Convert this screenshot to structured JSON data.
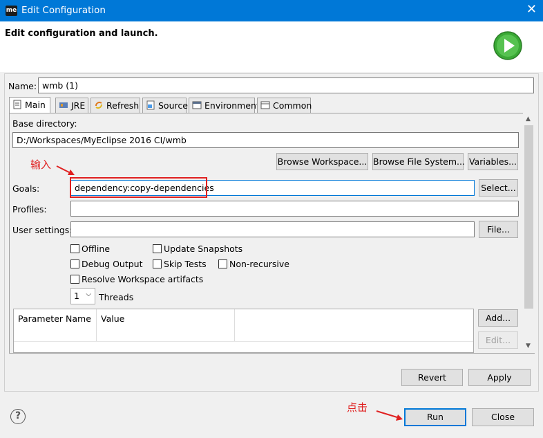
{
  "window": {
    "title": "Edit Configuration",
    "logo_text": "me"
  },
  "header": {
    "title": "Edit configuration and launch."
  },
  "name_field": {
    "label": "Name:",
    "value": "wmb (1)"
  },
  "tabs": [
    {
      "label": "Main",
      "icon": "page-icon"
    },
    {
      "label": "JRE",
      "icon": "jre-icon"
    },
    {
      "label": "Refresh",
      "icon": "refresh-icon"
    },
    {
      "label": "Source",
      "icon": "source-icon"
    },
    {
      "label": "Environment",
      "icon": "environment-icon"
    },
    {
      "label": "Common",
      "icon": "common-icon"
    }
  ],
  "main": {
    "base_directory_label": "Base directory:",
    "base_directory_value": "D:/Workspaces/MyEclipse 2016 CI/wmb",
    "browse_workspace": "Browse Workspace...",
    "browse_filesystem": "Browse File System...",
    "variables": "Variables...",
    "goals_label": "Goals:",
    "goals_value": "dependency:copy-dependencies",
    "select_btn": "Select...",
    "profiles_label": "Profiles:",
    "profiles_value": "",
    "user_settings_label": "User settings:",
    "user_settings_value": "",
    "file_btn": "File...",
    "checkboxes": {
      "offline": "Offline",
      "update_snapshots": "Update Snapshots",
      "debug_output": "Debug Output",
      "skip_tests": "Skip Tests",
      "non_recursive": "Non-recursive",
      "resolve_workspace": "Resolve Workspace artifacts"
    },
    "threads_value": "1",
    "threads_label": "Threads",
    "table_headers": [
      "Parameter Name",
      "Value"
    ],
    "add_btn": "Add...",
    "edit_btn": "Edit..."
  },
  "footer": {
    "revert": "Revert",
    "apply": "Apply",
    "run": "Run",
    "close": "Close",
    "help": "?"
  },
  "annotations": {
    "input_note": "输入",
    "click_note": "点击"
  },
  "colors": {
    "titlebar": "#0078d7",
    "annotation": "#e02020",
    "run_icon": "#3aa935"
  }
}
